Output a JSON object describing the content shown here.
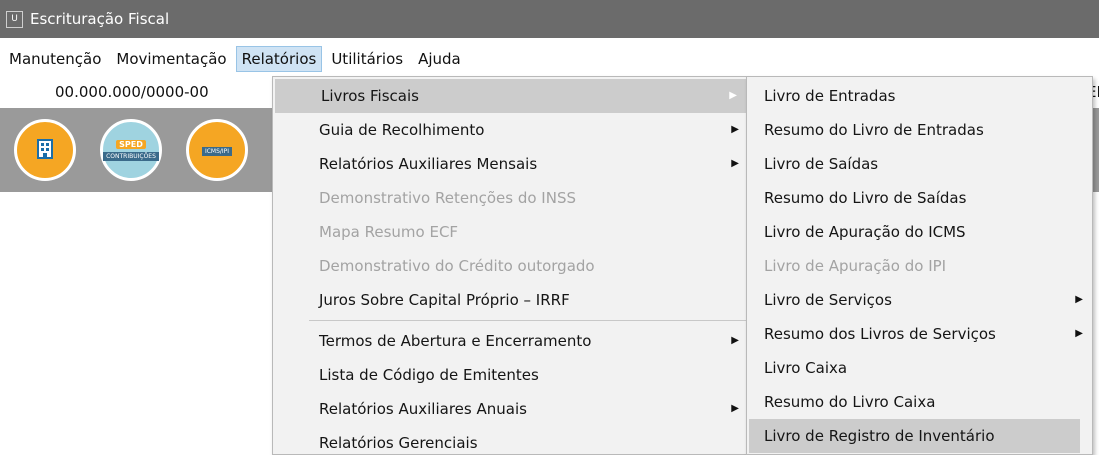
{
  "window": {
    "icon_text": "U",
    "title": "Escrituração Fiscal"
  },
  "menubar": {
    "items": [
      "Manutenção",
      "Movimentação",
      "Relatórios",
      "Utilitários",
      "Ajuda"
    ]
  },
  "company": {
    "cnpj": "00.000.000/0000-00",
    "edge_text": "EL"
  },
  "toolbar": {
    "buttons": [
      {
        "icon": "building-icon",
        "badge": "",
        "bar": ""
      },
      {
        "icon": "sped-contribuicoes-icon",
        "badge": "SPED",
        "bar": "CONTRIBUIÇÕES"
      },
      {
        "icon": "icms-ipi-icon",
        "badge": "",
        "bar": "ICMS/IPI"
      }
    ]
  },
  "relatorios_menu": {
    "items": [
      {
        "label": "Livros Fiscais",
        "state": "highlighted",
        "submenu": true
      },
      {
        "label": "Guia de Recolhimento",
        "state": "enabled",
        "submenu": true
      },
      {
        "label": "Relatórios Auxiliares Mensais",
        "state": "enabled",
        "submenu": true
      },
      {
        "label": "Demonstrativo Retenções do INSS",
        "state": "disabled",
        "submenu": false
      },
      {
        "label": "Mapa Resumo ECF",
        "state": "disabled",
        "submenu": false
      },
      {
        "label": "Demonstrativo do Crédito outorgado",
        "state": "disabled",
        "submenu": false
      },
      {
        "label": "Juros Sobre Capital Próprio – IRRF",
        "state": "enabled",
        "submenu": false
      },
      {
        "label": "Termos de Abertura e Encerramento",
        "state": "enabled",
        "submenu": true
      },
      {
        "label": "Lista de Código de Emitentes",
        "state": "enabled",
        "submenu": false
      },
      {
        "label": "Relatórios Auxiliares Anuais",
        "state": "enabled",
        "submenu": true
      },
      {
        "label": "Relatórios Gerenciais",
        "state": "enabled",
        "submenu": false
      }
    ]
  },
  "livros_fiscais_menu": {
    "items": [
      {
        "label": "Livro de Entradas",
        "state": "enabled",
        "submenu": false
      },
      {
        "label": "Resumo do Livro de Entradas",
        "state": "enabled",
        "submenu": false
      },
      {
        "label": "Livro de Saídas",
        "state": "enabled",
        "submenu": false
      },
      {
        "label": "Resumo do Livro de Saídas",
        "state": "enabled",
        "submenu": false
      },
      {
        "label": "Livro de Apuração do ICMS",
        "state": "enabled",
        "submenu": false
      },
      {
        "label": "Livro de Apuração do IPI",
        "state": "disabled",
        "submenu": false
      },
      {
        "label": "Livro de Serviços",
        "state": "enabled",
        "submenu": true
      },
      {
        "label": "Resumo dos Livros de Serviços",
        "state": "enabled",
        "submenu": true
      },
      {
        "label": "Livro Caixa",
        "state": "enabled",
        "submenu": false
      },
      {
        "label": "Resumo do Livro Caixa",
        "state": "enabled",
        "submenu": false
      },
      {
        "label": "Livro de Registro de Inventário",
        "state": "highlighted",
        "submenu": false
      }
    ]
  },
  "colors": {
    "titlebar": "#6b6b6b",
    "toolbar": "#9a9a9a",
    "menu_background": "#f2f2f2",
    "menu_highlight": "#cccccc",
    "active_menu": "#cfe3f4",
    "disabled_text": "#a3a3a3"
  }
}
